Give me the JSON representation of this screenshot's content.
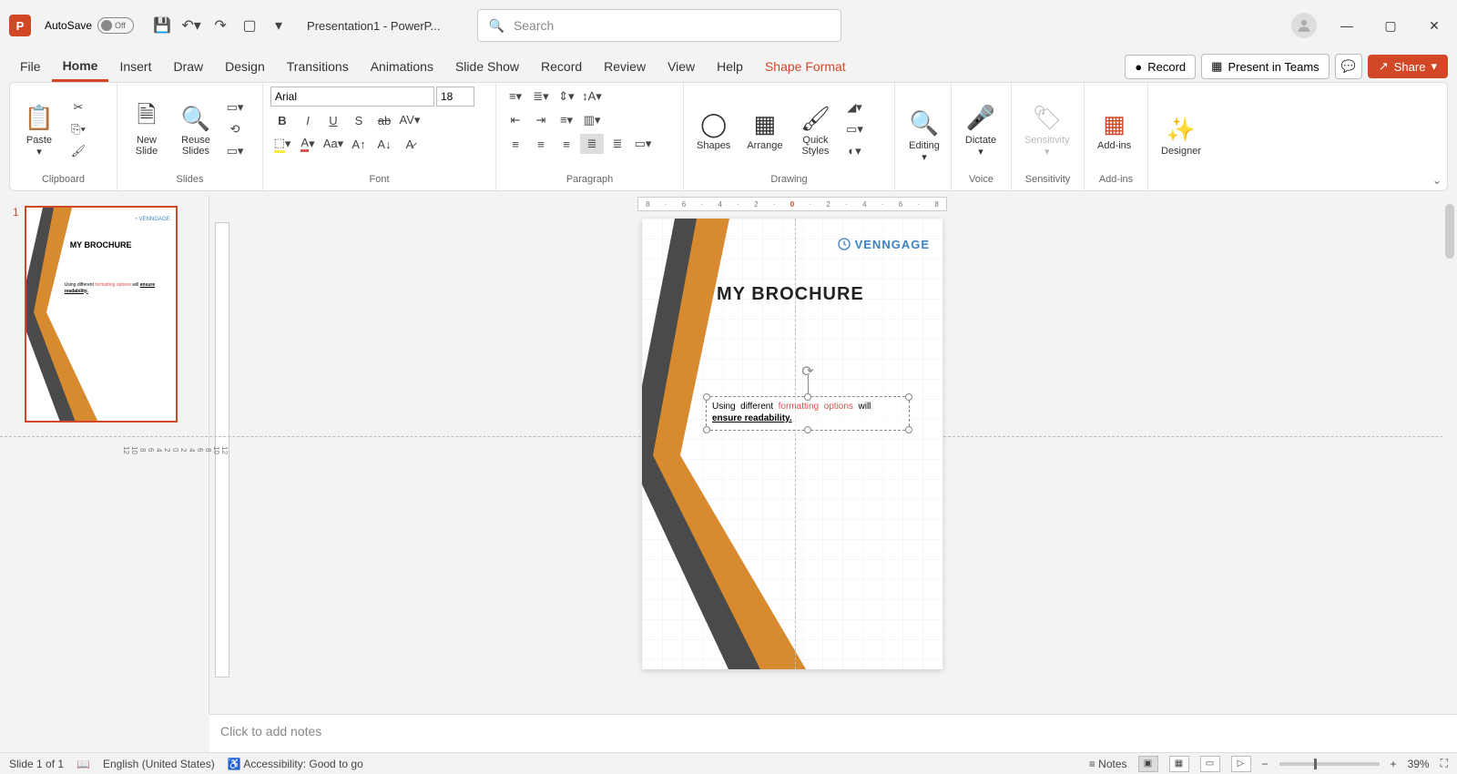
{
  "titleBar": {
    "autosave_label": "AutoSave",
    "autosave_state": "Off",
    "doc_title": "Presentation1  -  PowerP...",
    "search_placeholder": "Search"
  },
  "tabs": {
    "items": [
      "File",
      "Home",
      "Insert",
      "Draw",
      "Design",
      "Transitions",
      "Animations",
      "Slide Show",
      "Record",
      "Review",
      "View",
      "Help",
      "Shape Format"
    ],
    "active_index": 1,
    "context_index": 12,
    "record_btn": "Record",
    "present_btn": "Present in Teams",
    "share_btn": "Share"
  },
  "ribbon": {
    "clipboard": {
      "paste": "Paste",
      "label": "Clipboard"
    },
    "slides": {
      "new_slide": "New\nSlide",
      "reuse": "Reuse\nSlides",
      "label": "Slides"
    },
    "font": {
      "name": "Arial",
      "size": "18",
      "label": "Font"
    },
    "paragraph": {
      "label": "Paragraph"
    },
    "drawing": {
      "shapes": "Shapes",
      "arrange": "Arrange",
      "quick": "Quick\nStyles",
      "label": "Drawing"
    },
    "editing": {
      "label": "Editing",
      "btn": "Editing"
    },
    "voice": {
      "dictate": "Dictate",
      "label": "Voice"
    },
    "sensitivity": {
      "btn": "Sensitivity",
      "label": "Sensitivity"
    },
    "addins": {
      "btn": "Add-ins",
      "label": "Add-ins"
    },
    "designer": {
      "btn": "Designer"
    }
  },
  "thumb": {
    "number": "1",
    "title": "MY BROCHURE",
    "venn": "VENNGAGE",
    "body_plain": "Using different ",
    "body_red": "formatting options",
    "body_plain2": " will ",
    "body_bu": "ensure readability."
  },
  "slide": {
    "venn": "VENNGAGE",
    "title": "MY BROCHURE",
    "t1": "Using",
    "t2": "different",
    "t3": "formatting",
    "t4": "options",
    "t5": "will",
    "t6": "ensure readability."
  },
  "notes": {
    "placeholder": "Click to add notes"
  },
  "status": {
    "slide": "Slide 1 of 1",
    "lang": "English (United States)",
    "access": "Accessibility: Good to go",
    "notes": "Notes",
    "zoom": "39%"
  },
  "ruler": {
    "ticks": [
      "8",
      "6",
      "4",
      "2",
      "0",
      "2",
      "4",
      "6",
      "8"
    ],
    "vticks": [
      "12",
      "10",
      "8",
      "6",
      "4",
      "2",
      "0",
      "2",
      "4",
      "6",
      "8",
      "10",
      "12"
    ]
  }
}
